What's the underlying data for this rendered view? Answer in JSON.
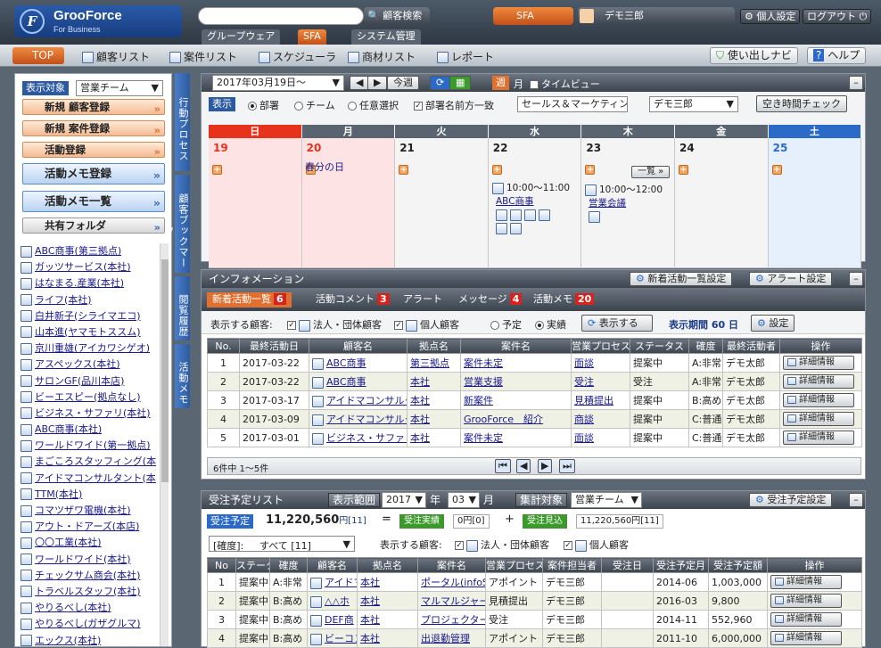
{
  "header": {
    "logo_text": "GrooForce",
    "logo_sub": "For Business",
    "search_button": "顧客検索",
    "sfa_label": "SFA",
    "user_name": "デモ三郎",
    "personal_settings": "個人設定",
    "logout": "ログアウト",
    "app_tabs": [
      "グループウェア",
      "SFA",
      "システム管理"
    ]
  },
  "nav": {
    "items": [
      "TOP",
      "顧客リスト",
      "案件リスト",
      "スケジューラ",
      "商材リスト",
      "レポート"
    ],
    "usage_navi": "使い出しナビ",
    "help": "ヘルプ"
  },
  "left": {
    "display_target_label": "表示対象",
    "display_target_value": "営業チーム",
    "buttons": [
      "新規 顧客登録",
      "新規 案件登録",
      "活動登録",
      "活動メモ登録",
      "活動メモ一覧",
      "共有フォルダ"
    ],
    "customers": [
      "ABC商事(第三拠点)",
      "ガッツサービス(本社)",
      "はなまる.産業(本社)",
      "ライフ(本社)",
      "白井新子(シライマエコ)",
      "山本進(ヤマモトススム)",
      "京川重雄(アイカワシゲオ)",
      "アスペックス(本社)",
      "サロンGF(品川本店)",
      "ビーエスピー(拠点なし)",
      "ビジネス・サファリ(本社)",
      "ABC商事(本社)",
      "ワールドワイド(第一拠点)",
      "まごころスタッフィング(本社)",
      "アイドマコンサルタント(本社)",
      "TTM(本社)",
      "コマツザワ電機(本社)",
      "アウト・ドアーズ(本店)",
      "〇〇工業(本社)",
      "ワールドワイド(本社)",
      "チェックサム商会(本社)",
      "トラベルスタッフ(本社)",
      "やりるべし(本社)",
      "やりるべし(ガザグルマ)",
      "エックス(本社)"
    ]
  },
  "vtabs": [
    "行動プロセス",
    "顧客ブックマーク",
    "閲覧履歴",
    "活動メモ"
  ],
  "calendar": {
    "date": "2017年03月19日～",
    "today": "今週",
    "week": "週",
    "month": "月",
    "timeview": "タイムビュー",
    "display": "表示",
    "radio": [
      "部署",
      "チーム",
      "任意選択"
    ],
    "exact_match": "部署名前方一致",
    "dept": "セールス＆マーケティング部",
    "person": "デモ三郎",
    "free_time": "空き時間チェック",
    "days": [
      "日",
      "月",
      "火",
      "水",
      "木",
      "金",
      "土"
    ],
    "dates": [
      "19",
      "20",
      "21",
      "22",
      "23",
      "24",
      "25"
    ],
    "holiday": "春分の日",
    "ev1_time": "10:00～11:00",
    "ev1_name": "ABC商事",
    "ev2_time": "10:00～12:00",
    "ev2_name": "営業会議",
    "list_btn": "一覧"
  },
  "info": {
    "title": "インフォメーション",
    "btn_new_setting": "新着活動一覧設定",
    "btn_alert_setting": "アラート設定",
    "tabs": [
      {
        "label": "新着活動一覧",
        "count": "6"
      },
      {
        "label": "活動コメント",
        "count": "3"
      },
      {
        "label": "アラート",
        "count": ""
      },
      {
        "label": "メッセージ",
        "count": "4"
      },
      {
        "label": "活動メモ",
        "count": "20"
      }
    ],
    "show_customers": "表示する顧客:",
    "corp": "法人・団体顧客",
    "indiv": "個人顧客",
    "planned": "予定",
    "actual": "実績",
    "show_btn": "表示する",
    "period": "表示期間 60 日",
    "setting": "設定",
    "columns": [
      "No.",
      "最終活動日",
      "顧客名",
      "拠点名",
      "案件名",
      "営業プロセス",
      "ステータス",
      "確度",
      "最終活動者",
      "操作"
    ],
    "rows": [
      [
        "1",
        "2017-03-22",
        "ABC商事",
        "第三拠点",
        "案件未定",
        "面談",
        "提案中",
        "A:非常",
        "デモ太郎"
      ],
      [
        "2",
        "2017-03-22",
        "ABC商事",
        "本社",
        "営業支援",
        "受注",
        "受注",
        "A:非常",
        "デモ太郎"
      ],
      [
        "3",
        "2017-03-17",
        "アイドマコンサルタント",
        "本社",
        "新案件",
        "見積提出",
        "提案中",
        "B:高め",
        "デモ太郎"
      ],
      [
        "4",
        "2017-03-09",
        "アイドマコンサルタント",
        "本社",
        "GrooForce　紹介",
        "商談",
        "提案中",
        "C:普通",
        "デモ太郎"
      ],
      [
        "5",
        "2017-03-01",
        "ビジネス・サファリ",
        "本社",
        "案件未定",
        "面談",
        "提案中",
        "C:普通",
        "デモ太郎"
      ]
    ],
    "detail": "詳細情報",
    "paging": "6件中 1～5件"
  },
  "orders": {
    "title": "受注予定リスト",
    "range_label": "表示範囲",
    "year": "2017",
    "year_unit": "年",
    "month": "03",
    "month_unit": "月",
    "target_label": "集計対象",
    "target_value": "営業チーム",
    "setting_btn": "受注予定設定",
    "planned_label": "受注予定",
    "planned_value": "11,220,560",
    "planned_unit": "円",
    "planned_count": "[11]",
    "eq": "=",
    "actual_label": "受注実績",
    "actual_value": "0円[0]",
    "plus": "+",
    "forecast_label": "受注見込",
    "forecast_value": "11,220,560円[11]",
    "certainty_label": "[確度]:",
    "certainty_value": "すべて [11]",
    "show_customers": "表示する顧客:",
    "corp": "法人・団体顧客",
    "indiv": "個人顧客",
    "columns": [
      "No",
      "ステータス",
      "確度",
      "顧客名",
      "拠点名",
      "案件名",
      "営業プロセス",
      "案件担当者",
      "受注日",
      "受注予定月",
      "受注予定額",
      "操作"
    ],
    "rows": [
      [
        "1",
        "提案中",
        "A:非常",
        "アイドマ",
        "本社",
        "ポータル(infoSeek)",
        "アポイント",
        "デモ三郎",
        "",
        "2014-06",
        "1,003,000"
      ],
      [
        "2",
        "提案中",
        "B:高め",
        "△△ホ",
        "本社",
        "マルマルジャーナル",
        "見積提出",
        "デモ三郎",
        "",
        "2016-03",
        "9,800"
      ],
      [
        "3",
        "提案中",
        "B:高め",
        "DEF商",
        "本社",
        "プロジェクター導入",
        "受注",
        "デモ三郎",
        "",
        "2014-11",
        "552,960"
      ],
      [
        "4",
        "提案中",
        "B:高め",
        "ビーコン",
        "本社",
        "出退勤管理",
        "アポイント",
        "デモ三郎",
        "",
        "2011-10",
        "6,000,000"
      ]
    ],
    "detail": "詳細情報"
  }
}
